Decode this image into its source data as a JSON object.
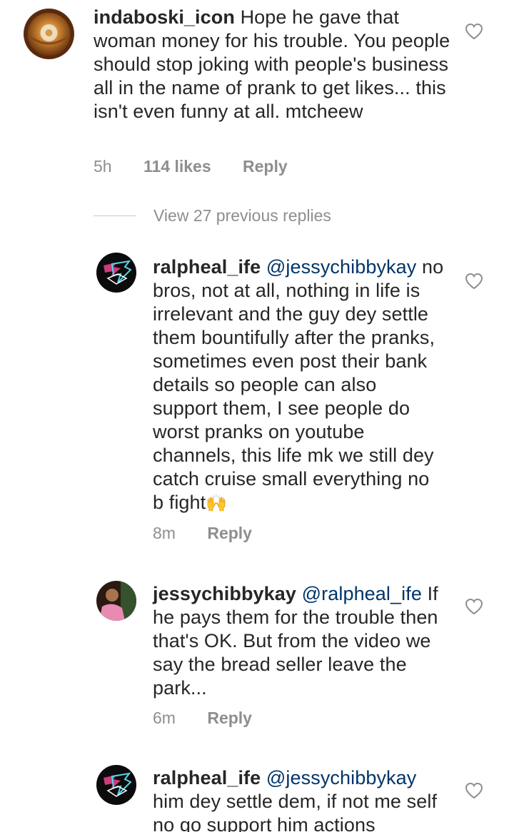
{
  "comments": [
    {
      "username": "indaboski_icon",
      "mention": "",
      "text": "Hope he gave that woman money for his trouble. You people should stop joking with people's business all in the name of prank to get likes... this isn't even funny at all. mtcheew",
      "time": "5h",
      "likes": "114 likes",
      "reply_label": "Reply",
      "avatar_icon": "cake-photo-avatar"
    }
  ],
  "view_replies": {
    "label": "View 27 previous replies"
  },
  "replies": [
    {
      "username": "ralpheal_ife",
      "mention": "@jessychibbykay",
      "text": "no bros, not at all, nothing in life is irrelevant and the guy dey settle them bountifully after the pranks, sometimes even post their bank details so people can also support them, I see people do worst pranks on youtube channels, this life mk we still dey catch cruise small everything no b fight",
      "emoji": "🙌",
      "time": "8m",
      "reply_label": "Reply",
      "avatar_icon": "tr-logo-avatar"
    },
    {
      "username": "jessychibbykay",
      "mention": "@ralpheal_ife",
      "text": "If he pays them for the trouble then that's OK. But from the video we say the bread seller leave the park...",
      "time": "6m",
      "reply_label": "Reply",
      "avatar_icon": "person-photo-avatar"
    },
    {
      "username": "ralpheal_ife",
      "mention": "@jessychibbykay",
      "text": "him dey settle dem, if not me self no go support him actions",
      "time": "",
      "reply_label": "",
      "avatar_icon": "tr-logo-avatar"
    }
  ],
  "colors": {
    "text": "#262626",
    "muted": "#8e8e8e",
    "mention": "#003569",
    "divider": "#c7c7c7"
  }
}
